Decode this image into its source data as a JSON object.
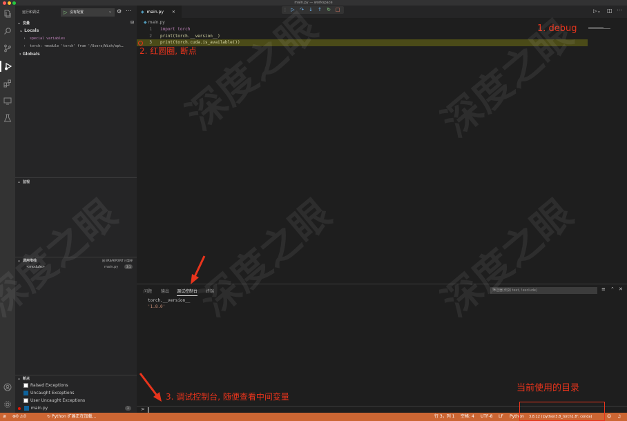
{
  "window": {
    "title": "main.py — workspace"
  },
  "sidebar": {
    "header": "运行和调试",
    "launch_config": "没有配置",
    "variables": {
      "title": "变量",
      "locals_label": "Locals",
      "special_vars": "special variables",
      "torch_var": "torch: <module 'torch' from '/Users/Wish/opt…",
      "globals_label": "Globals"
    },
    "watch": {
      "title": "监视"
    },
    "callstack": {
      "title": "调用堆栈",
      "status": "因 BREAKPOINT 已暂停",
      "frame_name": "<module>",
      "frame_file": "main.py",
      "frame_line": "3:1"
    },
    "breakpoints": {
      "title": "断点",
      "items": [
        {
          "label": "Raised Exceptions",
          "checked": false
        },
        {
          "label": "Uncaught Exceptions",
          "checked": true
        },
        {
          "label": "User Uncaught Exceptions",
          "checked": false
        },
        {
          "label": "main.py",
          "checked": true,
          "count": "3"
        }
      ]
    }
  },
  "editor": {
    "tab_label": "main.py",
    "breadcrumb": "main.py",
    "lines": [
      {
        "num": "1",
        "text": "import torch"
      },
      {
        "num": "2",
        "text": "print(torch.__version__)"
      },
      {
        "num": "3",
        "text": "print(torch.cuda.is_available())"
      }
    ]
  },
  "panel": {
    "tabs": [
      "问题",
      "输出",
      "调试控制台",
      "终端"
    ],
    "active_tab_index": 2,
    "filter_placeholder": "筛选器(例如 text, !exclude)",
    "console_lines": [
      "torch.__version__",
      "'1.8.0'"
    ],
    "prompt": ">"
  },
  "statusbar": {
    "errors": "0",
    "warnings": "0",
    "python_loading": "Python 扩展正在加载...",
    "position": "行 3，列 1",
    "spaces": "空格: 4",
    "encoding": "UTF-8",
    "eol": "LF",
    "language": "Python",
    "interpreter": "3.8.12 ('python3.8_torch1.8': conda)"
  },
  "annotations": {
    "debug": "1. debug",
    "breakpoint": "2. 红圆圈, 断点",
    "console": "3. 调试控制台, 随便查看中间变量",
    "directory": "当前使用的目录"
  },
  "watermark": "深度之眼",
  "colors": {
    "accent_status": "#cc6633",
    "annotation": "#e8341c",
    "debug_line": "#4b4b18"
  }
}
